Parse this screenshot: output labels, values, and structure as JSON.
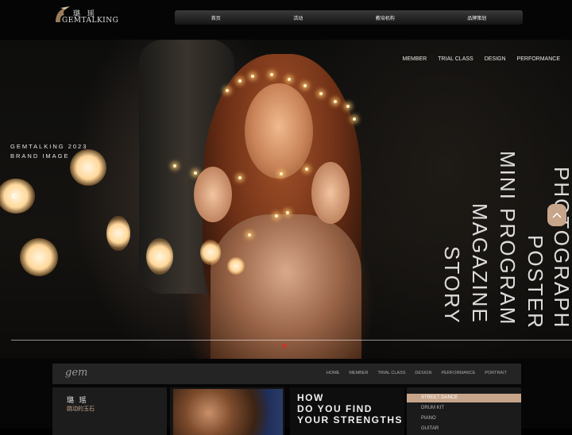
{
  "header": {
    "logo_cn": "璐 瑶",
    "logo_en": "GEMTALKING",
    "nav": [
      "首页",
      "活动",
      "教培机构",
      "品牌策划"
    ]
  },
  "hero": {
    "nav": [
      "MEMBER",
      "TRIAL CLASS",
      "DESIGN",
      "PERFORMANCE"
    ],
    "brand_line1": "GEMTALKING 2023",
    "brand_line2": "BRAND IMAGE",
    "vertical_lines": [
      "PHOTOGRAPH",
      "POSTER",
      "MINI PROGRAM",
      "MAGAZINE",
      "STORY"
    ],
    "prev_icon": "chevron-left-icon",
    "next_icon": "chevron-up-icon"
  },
  "subnav": {
    "signature": "gem",
    "links": [
      "HOME",
      "MEMBER",
      "TRIAL CLASS",
      "DESIGN",
      "PERFORMANCE",
      "PORTRAIT"
    ]
  },
  "cards": {
    "title_cn": "璐 瑶",
    "subtitle_cn": "跳动的玉石",
    "headline": [
      "HOW",
      "DO YOU FIND",
      "YOUR STRENGTHS"
    ],
    "list": [
      "STREET DANCE",
      "DRUM KIT",
      "PIANO",
      "GUITAR"
    ],
    "active_item": "STREET DANCE"
  },
  "colors": {
    "accent": "#c7a58a",
    "progress_dot": "#c23a2a"
  }
}
